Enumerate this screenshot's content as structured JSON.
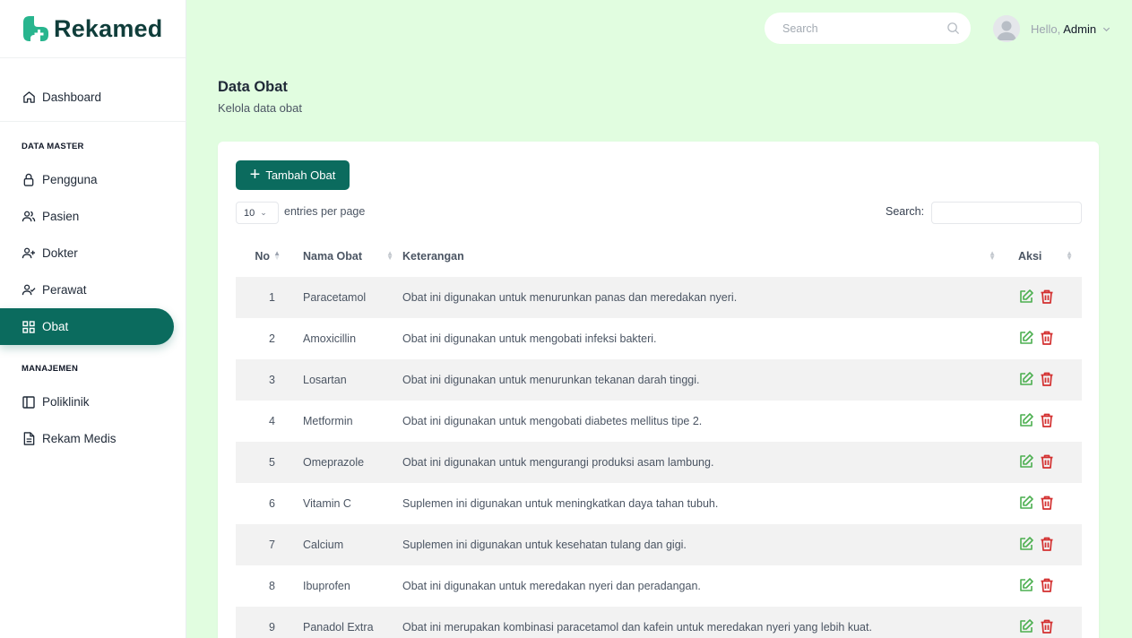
{
  "brand": {
    "name": "Rekamed",
    "accent": "#0b6b5e",
    "logo_color": "#28b58e"
  },
  "topbar": {
    "search_placeholder": "Search",
    "greeting": "Hello,",
    "user_name": "Admin"
  },
  "sidebar": {
    "dashboard": "Dashboard",
    "section_master": "DATA MASTER",
    "master_items": [
      {
        "label": "Pengguna",
        "icon": "lock-icon"
      },
      {
        "label": "Pasien",
        "icon": "users-icon"
      },
      {
        "label": "Dokter",
        "icon": "user-plus-icon"
      },
      {
        "label": "Perawat",
        "icon": "user-check-icon"
      },
      {
        "label": "Obat",
        "icon": "grid-icon",
        "active": true
      }
    ],
    "section_manage": "MANAJEMEN",
    "manage_items": [
      {
        "label": "Poliklinik",
        "icon": "sidebar-panel-icon"
      },
      {
        "label": "Rekam Medis",
        "icon": "document-icon"
      }
    ]
  },
  "page": {
    "title": "Data Obat",
    "subtitle": "Kelola data obat"
  },
  "table_controls": {
    "add_button": "Tambah Obat",
    "page_length": "10",
    "page_length_label": "entries per page",
    "search_label": "Search:"
  },
  "table": {
    "headers": {
      "no": "No",
      "nama": "Nama Obat",
      "ket": "Keterangan",
      "aksi": "Aksi"
    },
    "rows": [
      {
        "no": "1",
        "nama": "Paracetamol",
        "ket": "Obat ini digunakan untuk menurunkan panas dan meredakan nyeri."
      },
      {
        "no": "2",
        "nama": "Amoxicillin",
        "ket": "Obat ini digunakan untuk mengobati infeksi bakteri."
      },
      {
        "no": "3",
        "nama": "Losartan",
        "ket": "Obat ini digunakan untuk menurunkan tekanan darah tinggi."
      },
      {
        "no": "4",
        "nama": "Metformin",
        "ket": "Obat ini digunakan untuk mengobati diabetes mellitus tipe 2."
      },
      {
        "no": "5",
        "nama": "Omeprazole",
        "ket": "Obat ini digunakan untuk mengurangi produksi asam lambung."
      },
      {
        "no": "6",
        "nama": "Vitamin C",
        "ket": "Suplemen ini digunakan untuk meningkatkan daya tahan tubuh."
      },
      {
        "no": "7",
        "nama": "Calcium",
        "ket": "Suplemen ini digunakan untuk kesehatan tulang dan gigi."
      },
      {
        "no": "8",
        "nama": "Ibuprofen",
        "ket": "Obat ini digunakan untuk meredakan nyeri dan peradangan."
      },
      {
        "no": "9",
        "nama": "Panadol Extra",
        "ket": "Obat ini merupakan kombinasi paracetamol dan kafein untuk meredakan nyeri yang lebih kuat."
      }
    ]
  },
  "colors": {
    "edit": "#4caf50",
    "delete": "#d32f2f",
    "background": "#e1fde0"
  }
}
